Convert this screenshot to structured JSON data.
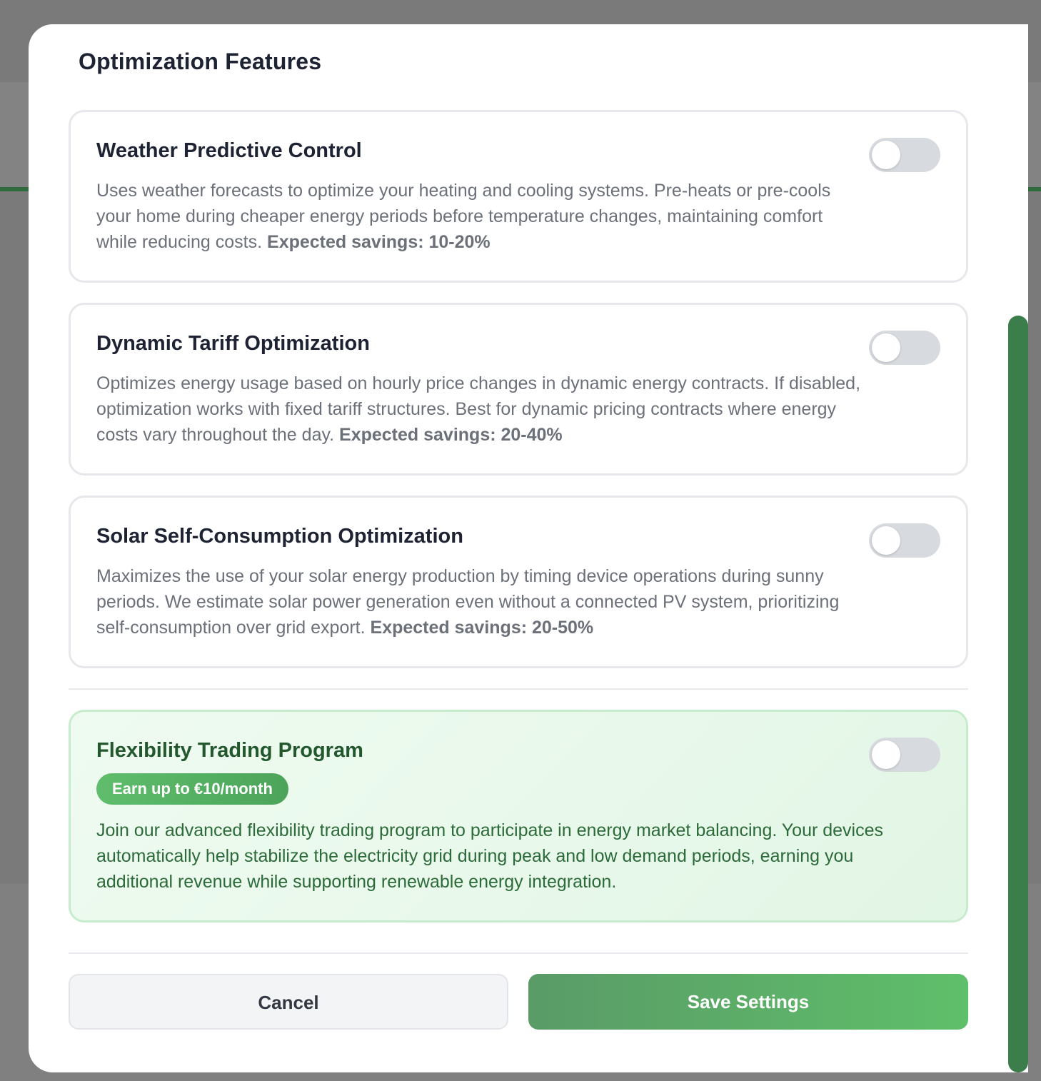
{
  "modal": {
    "title": "Optimization Features"
  },
  "features": [
    {
      "title": "Weather Predictive Control",
      "description": "Uses weather forecasts to optimize your heating and cooling systems. Pre-heats or pre-cools your home during cheaper energy periods before temperature changes, maintaining comfort while reducing costs.",
      "savings": "Expected savings: 10-20%",
      "enabled": false
    },
    {
      "title": "Dynamic Tariff Optimization",
      "description": "Optimizes energy usage based on hourly price changes in dynamic energy contracts. If disabled, optimization works with fixed tariff structures. Best for dynamic pricing contracts where energy costs vary throughout the day.",
      "savings": "Expected savings: 20-40%",
      "enabled": false
    },
    {
      "title": "Solar Self-Consumption Optimization",
      "description": "Maximizes the use of your solar energy production by timing device operations during sunny periods. We estimate solar power generation even without a connected PV system, prioritizing self-consumption over grid export.",
      "savings": "Expected savings: 20-50%",
      "enabled": false
    }
  ],
  "flexibility": {
    "title": "Flexibility Trading Program",
    "badge": "Earn up to €10/month",
    "description": "Join our advanced flexibility trading program to participate in energy market balancing. Your devices automatically help stabilize the electricity grid during peak and low demand periods, earning you additional revenue while supporting renewable energy integration.",
    "enabled": false
  },
  "actions": {
    "cancel_label": "Cancel",
    "save_label": "Save Settings"
  },
  "colors": {
    "accent": "#5fbf6a",
    "accent_dark": "#3b7e4c",
    "green_text": "#23582e"
  }
}
